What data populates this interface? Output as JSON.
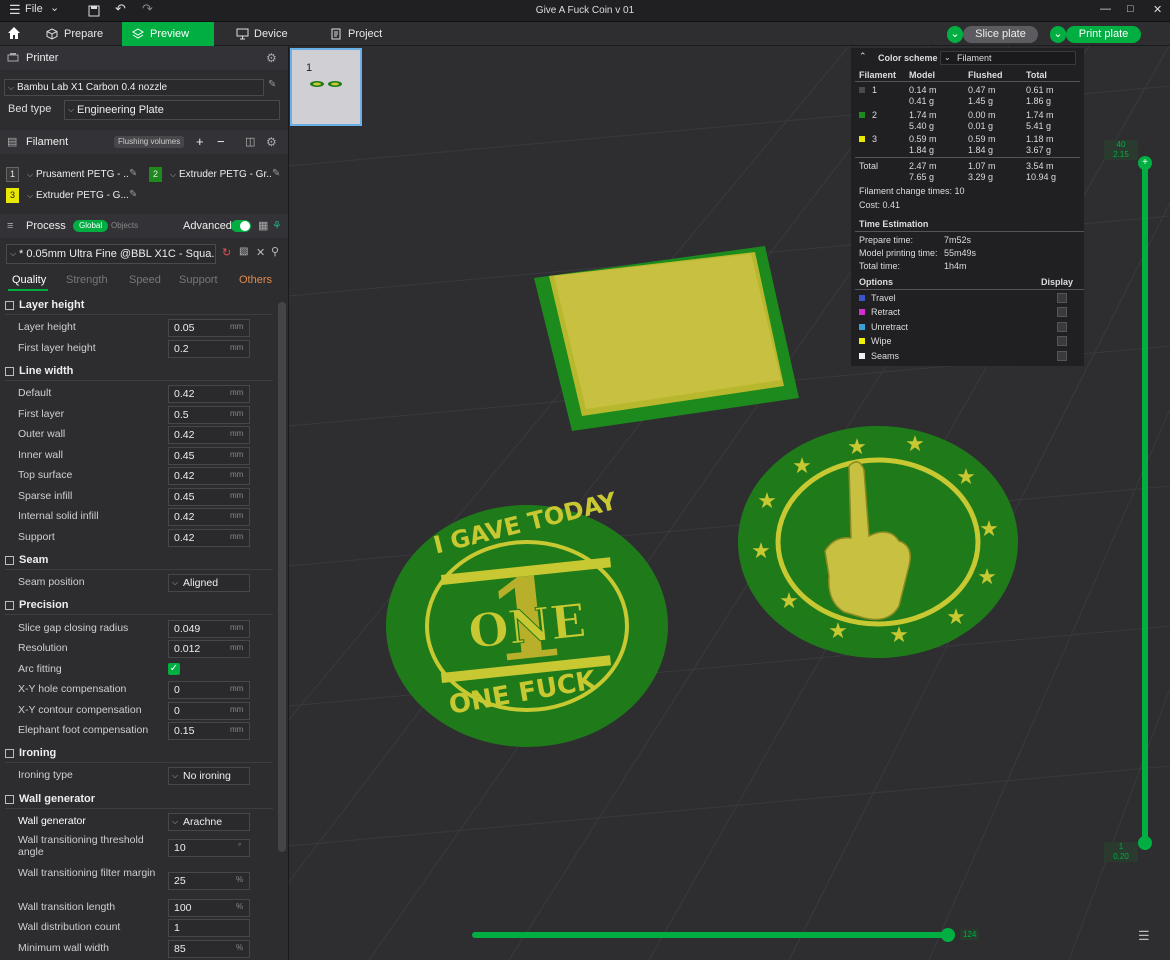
{
  "app": {
    "title": "Give A Fuck Coin v 01",
    "file_menu": "File"
  },
  "tabs": [
    {
      "label": "Prepare"
    },
    {
      "label": "Preview"
    },
    {
      "label": "Device"
    },
    {
      "label": "Project"
    }
  ],
  "actions": {
    "slice": "Slice plate",
    "print": "Print plate"
  },
  "printer": {
    "section": "Printer",
    "name": "Bambu Lab X1 Carbon 0.4 nozzle",
    "bed_label": "Bed type",
    "bed_value": "Engineering Plate"
  },
  "filament": {
    "section": "Filament",
    "flushing": "Flushing volumes",
    "slots": [
      {
        "num": "1",
        "name": "Prusament PETG - ...",
        "color": "#3a3a3a"
      },
      {
        "num": "2",
        "name": "Extruder PETG - Gr...",
        "color": "#1e8a1e"
      },
      {
        "num": "3",
        "name": "Extruder PETG - G...",
        "color": "#e8e800"
      }
    ]
  },
  "process": {
    "section": "Process",
    "global": "Global",
    "objects": "Objects",
    "advanced": "Advanced",
    "preset": "* 0.05mm Ultra Fine @BBL X1C - Squa...",
    "tabs": [
      "Quality",
      "Strength",
      "Speed",
      "Support",
      "Others"
    ]
  },
  "settings": {
    "layer_height": {
      "title": "Layer height",
      "rows": [
        {
          "label": "Layer height",
          "value": "0.05",
          "unit": "mm"
        },
        {
          "label": "First layer height",
          "value": "0.2",
          "unit": "mm"
        }
      ]
    },
    "line_width": {
      "title": "Line width",
      "rows": [
        {
          "label": "Default",
          "value": "0.42",
          "unit": "mm"
        },
        {
          "label": "First layer",
          "value": "0.5",
          "unit": "mm"
        },
        {
          "label": "Outer wall",
          "value": "0.42",
          "unit": "mm"
        },
        {
          "label": "Inner wall",
          "value": "0.45",
          "unit": "mm"
        },
        {
          "label": "Top surface",
          "value": "0.42",
          "unit": "mm"
        },
        {
          "label": "Sparse infill",
          "value": "0.45",
          "unit": "mm"
        },
        {
          "label": "Internal solid infill",
          "value": "0.42",
          "unit": "mm"
        },
        {
          "label": "Support",
          "value": "0.42",
          "unit": "mm"
        }
      ]
    },
    "seam": {
      "title": "Seam",
      "rows": [
        {
          "label": "Seam position",
          "value": "Aligned"
        }
      ]
    },
    "precision": {
      "title": "Precision",
      "rows": [
        {
          "label": "Slice gap closing radius",
          "value": "0.049",
          "unit": "mm"
        },
        {
          "label": "Resolution",
          "value": "0.012",
          "unit": "mm"
        },
        {
          "label": "Arc fitting",
          "value": ""
        },
        {
          "label": "X-Y hole compensation",
          "value": "0",
          "unit": "mm"
        },
        {
          "label": "X-Y contour compensation",
          "value": "0",
          "unit": "mm"
        },
        {
          "label": "Elephant foot compensation",
          "value": "0.15",
          "unit": "mm"
        }
      ]
    },
    "ironing": {
      "title": "Ironing",
      "rows": [
        {
          "label": "Ironing type",
          "value": "No ironing"
        }
      ]
    },
    "wall_generator": {
      "title": "Wall generator",
      "rows": [
        {
          "label": "Wall generator",
          "value": "Arachne"
        },
        {
          "label": "Wall transitioning threshold angle",
          "value": "10",
          "unit": "°"
        },
        {
          "label": "Wall transitioning filter margin",
          "value": "25",
          "unit": "%"
        },
        {
          "label": "Wall transition length",
          "value": "100",
          "unit": "%"
        },
        {
          "label": "Wall distribution count",
          "value": "1"
        },
        {
          "label": "Minimum wall width",
          "value": "85",
          "unit": "%"
        }
      ]
    }
  },
  "plate": {
    "number": "1"
  },
  "legend": {
    "color_scheme_label": "Color scheme",
    "color_scheme_value": "Filament",
    "headers": [
      "Filament",
      "Model",
      "Flushed",
      "Total"
    ],
    "rows": [
      {
        "id": "1",
        "color": "#4a4a4a",
        "model_m": "0.14 m",
        "model_g": "0.41 g",
        "flushed_m": "0.47 m",
        "flushed_g": "1.45 g",
        "total_m": "0.61 m",
        "total_g": "1.86 g"
      },
      {
        "id": "2",
        "color": "#1e8a1e",
        "model_m": "1.74 m",
        "model_g": "5.40 g",
        "flushed_m": "0.00 m",
        "flushed_g": "0.01 g",
        "total_m": "1.74 m",
        "total_g": "5.41 g"
      },
      {
        "id": "3",
        "color": "#e8e800",
        "model_m": "0.59 m",
        "model_g": "1.84 g",
        "flushed_m": "0.59 m",
        "flushed_g": "1.84 g",
        "total_m": "1.18 m",
        "total_g": "3.67 g"
      }
    ],
    "total": {
      "label": "Total",
      "model_m": "2.47 m",
      "model_g": "7.65 g",
      "flushed_m": "1.07 m",
      "flushed_g": "3.29 g",
      "total_m": "3.54 m",
      "total_g": "10.94 g"
    },
    "change_times": "Filament change times:  10",
    "cost": "Cost:  0.41",
    "time_title": "Time Estimation",
    "prepare_label": "Prepare time:",
    "prepare_value": "7m52s",
    "model_label": "Model printing time:",
    "model_value": "55m49s",
    "total_label": "Total time:",
    "total_value": "1h4m",
    "options_title": "Options",
    "display_title": "Display",
    "options": [
      {
        "label": "Travel",
        "color": "#3a55c8"
      },
      {
        "label": "Retract",
        "color": "#d030d0"
      },
      {
        "label": "Unretract",
        "color": "#3aa0d8"
      },
      {
        "label": "Wipe",
        "color": "#f0f000"
      },
      {
        "label": "Seams",
        "color": "#f0f0f0"
      }
    ]
  },
  "slider": {
    "top_layer": "40",
    "top_height": "2.15",
    "bottom_layer": "1",
    "bottom_height": "0.20",
    "move_value": "124"
  },
  "coins": {
    "left_top": "I GAVE TODAY",
    "left_bottom": "ONE FUCK",
    "left_center": "ONE",
    "left_digit": "1"
  },
  "colors": {
    "accent": "#00ae42",
    "coin_green": "#1f7a1a",
    "coin_yellow": "#c8c832",
    "plate_green": "#1c8a1c",
    "plate_yellow": "#c8c040"
  }
}
